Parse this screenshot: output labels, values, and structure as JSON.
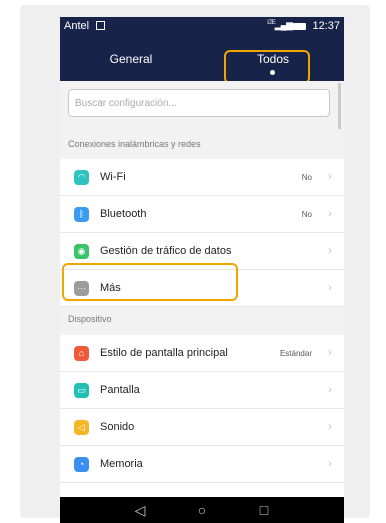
{
  "status_bar": {
    "carrier": "Antel",
    "network": "LTE",
    "time": "12:37"
  },
  "tabs": [
    {
      "label": "General",
      "selected": false
    },
    {
      "label": "Todos",
      "selected": true
    }
  ],
  "search": {
    "placeholder": "Buscar configuración..."
  },
  "sections": [
    {
      "header": "Conexiones inalámbricas y redes",
      "items": [
        {
          "label": "Wi-Fi",
          "value": "No",
          "icon": "wifi-icon",
          "icon_color": "#2ec3c1",
          "icon_glyph": "◠"
        },
        {
          "label": "Bluetooth",
          "value": "No",
          "icon": "bluetooth-icon",
          "icon_color": "#3a9bf0",
          "icon_glyph": "ᛒ"
        },
        {
          "label": "Gestión de tráfico de datos",
          "value": "",
          "icon": "data-traffic-icon",
          "icon_color": "#39c36b",
          "icon_glyph": "◉"
        },
        {
          "label": "Más",
          "value": "",
          "icon": "more-icon",
          "icon_color": "#9c9c9c",
          "icon_glyph": "···"
        }
      ]
    },
    {
      "header": "Dispositivo",
      "items": [
        {
          "label": "Estilo de pantalla principal",
          "value": "Estándar",
          "icon": "home-style-icon",
          "icon_color": "#f05a3a",
          "icon_glyph": "⌂"
        },
        {
          "label": "Pantalla",
          "value": "",
          "icon": "display-icon",
          "icon_color": "#22bfb3",
          "icon_glyph": "▭"
        },
        {
          "label": "Sonido",
          "value": "",
          "icon": "sound-icon",
          "icon_color": "#f6b626",
          "icon_glyph": "◁"
        },
        {
          "label": "Memoria",
          "value": "",
          "icon": "memory-icon",
          "icon_color": "#3a8ff0",
          "icon_glyph": "◔"
        }
      ]
    }
  ],
  "nav": {
    "back": "◁",
    "home": "○",
    "recent": "□"
  },
  "highlight_color": "#f0a500"
}
